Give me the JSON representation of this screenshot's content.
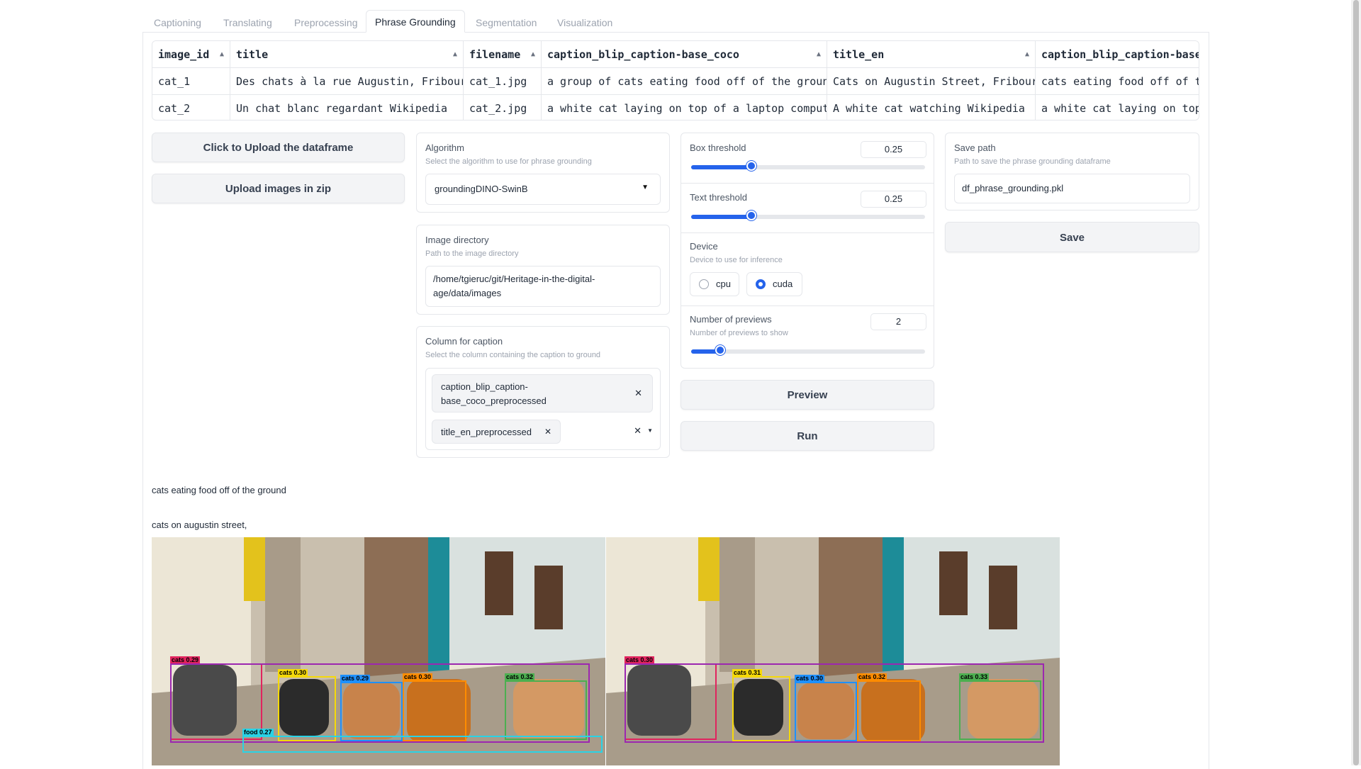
{
  "tabs": [
    {
      "label": "Captioning",
      "active": false
    },
    {
      "label": "Translating",
      "active": false
    },
    {
      "label": "Preprocessing",
      "active": false
    },
    {
      "label": "Phrase Grounding",
      "active": true
    },
    {
      "label": "Segmentation",
      "active": false
    },
    {
      "label": "Visualization",
      "active": false
    }
  ],
  "table": {
    "columns": [
      "image_id",
      "title",
      "filename",
      "caption_blip_caption-base_coco",
      "title_en",
      "caption_blip_caption-base_c"
    ],
    "rows": [
      [
        "cat_1",
        "Des chats à la rue Augustin, Fribourg",
        "cat_1.jpg",
        "a group of cats eating food off of the ground",
        "Cats on Augustin Street, Fribourg",
        "cats eating food off of the"
      ],
      [
        "cat_2",
        "Un chat blanc regardant Wikipedia",
        "cat_2.jpg",
        "a white cat laying on top of a laptop computer",
        "A white cat watching Wikipedia",
        "a white cat laying on top c"
      ]
    ]
  },
  "upload": {
    "dataframe_label": "Click to Upload the dataframe",
    "images_label": "Upload images in zip"
  },
  "algorithm": {
    "label": "Algorithm",
    "info": "Select the algorithm to use for phrase grounding",
    "value": "groundingDINO-SwinB"
  },
  "image_dir": {
    "label": "Image directory",
    "info": "Path to the image directory",
    "value": "/home/tgieruc/git/Heritage-in-the-digital-age/data/images",
    "line1": "/home/tgieruc/git/Heritage-in-the-digital-",
    "line2": "age/data/images"
  },
  "caption_column": {
    "label": "Column for caption",
    "info": "Select the column containing the caption to ground",
    "chip1_line1": "caption_blip_caption-",
    "chip1_line2": "base_coco_preprocessed",
    "chip2": "title_en_preprocessed"
  },
  "box_threshold": {
    "label": "Box threshold",
    "value": "0.25",
    "fraction": 0.25
  },
  "text_threshold": {
    "label": "Text threshold",
    "value": "0.25",
    "fraction": 0.25
  },
  "device": {
    "label": "Device",
    "info": "Device to use for inference",
    "options": [
      "cpu",
      "cuda"
    ],
    "selected": "cuda"
  },
  "previews": {
    "label": "Number of previews",
    "info": "Number of previews to show",
    "value": "2",
    "fraction": 0.1
  },
  "actions": {
    "preview": "Preview",
    "run": "Run"
  },
  "save": {
    "label": "Save path",
    "info": "Path to save the phrase grounding dataframe",
    "value": "df_phrase_grounding.pkl",
    "button": "Save"
  },
  "output": {
    "line1": "cats eating food off of the ground",
    "line2": "cats on augustin street,"
  },
  "detections": {
    "left": [
      {
        "label": "cats 0.29"
      },
      {
        "label": "cats 0.30"
      },
      {
        "label": "cats 0.29"
      },
      {
        "label": "cats 0.30"
      },
      {
        "label": "cats 0.32"
      },
      {
        "label": "food 0.27"
      }
    ],
    "right": [
      {
        "label": "cats 0.30"
      },
      {
        "label": "cats 0.31"
      },
      {
        "label": "cats 0.30"
      },
      {
        "label": "cats 0.32"
      },
      {
        "label": "cats 0.33"
      }
    ]
  },
  "colors": {
    "accent": "#2563eb",
    "box_red": "#e0245e",
    "box_purple": "#9c27b0",
    "box_yellow": "#f5d90a",
    "box_blue": "#1e90ff",
    "box_orange": "#ff8c00",
    "box_green": "#4caf50",
    "box_cyan": "#29d3e6"
  }
}
